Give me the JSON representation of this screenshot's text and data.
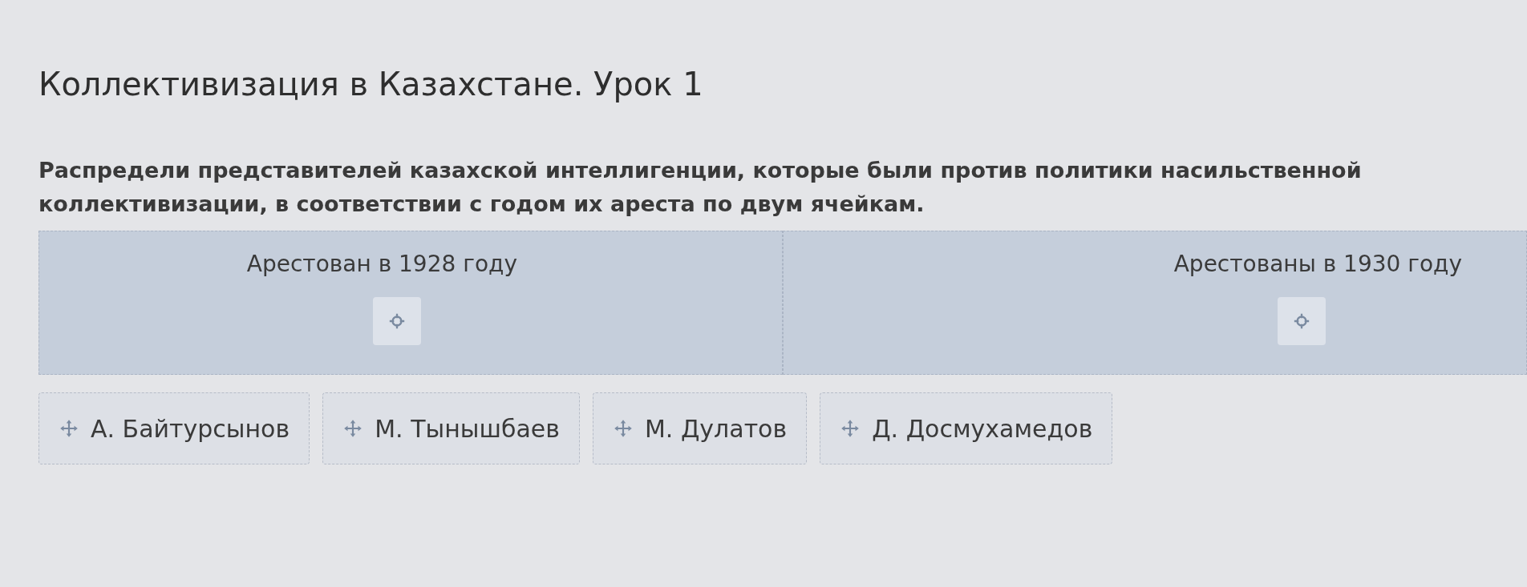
{
  "title": "Коллективизация в Казахстане. Урок 1",
  "question": "Распредели представителей казахской интеллигенции, которые были против политики насильственной коллективизации, в соответствии с годом их ареста по двум ячейкам.",
  "zones": [
    {
      "label": "Арестован в 1928 году"
    },
    {
      "label": "Арестованы в 1930 году"
    }
  ],
  "items": [
    {
      "label": "А. Байтурсынов"
    },
    {
      "label": "М. Тынышбаев"
    },
    {
      "label": "М. Дулатов"
    },
    {
      "label": "Д. Досмухамедов"
    }
  ]
}
